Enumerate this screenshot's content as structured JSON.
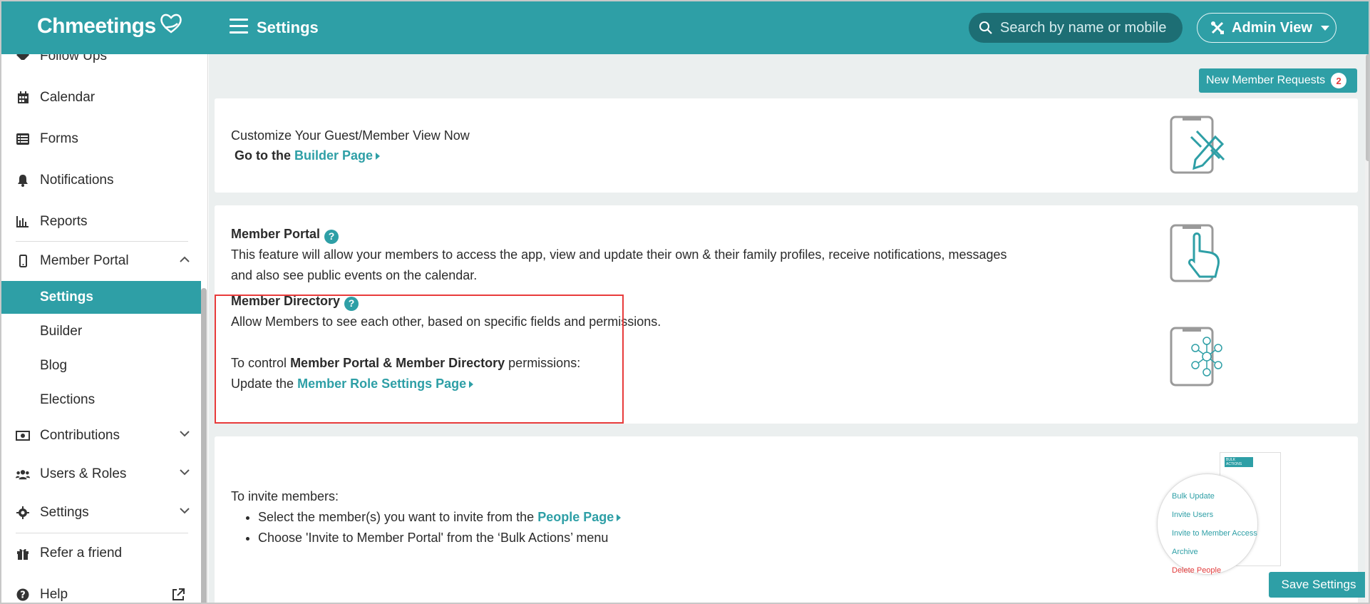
{
  "app": {
    "logo_text": "Chmeetings",
    "page_title": "Settings",
    "brand_color": "#2e9fa6"
  },
  "header": {
    "search_placeholder": "Search by name or mobile",
    "admin_view_label": "Admin View"
  },
  "sidebar": {
    "items": [
      {
        "label": "Follow Ups",
        "icon": "handshake-icon"
      },
      {
        "label": "Calendar",
        "icon": "calendar-icon"
      },
      {
        "label": "Forms",
        "icon": "list-icon"
      },
      {
        "label": "Notifications",
        "icon": "bell-icon"
      },
      {
        "label": "Reports",
        "icon": "bar-chart-icon"
      },
      {
        "label": "Member Portal",
        "icon": "mobile-icon"
      },
      {
        "label": "Contributions",
        "icon": "money-icon"
      },
      {
        "label": "Users & Roles",
        "icon": "users-icon"
      },
      {
        "label": "Settings",
        "icon": "gear-icon"
      },
      {
        "label": "Refer a friend",
        "icon": "gift-icon"
      },
      {
        "label": "Help",
        "icon": "question-icon"
      }
    ],
    "member_portal_sub": [
      "Settings",
      "Builder",
      "Blog",
      "Elections"
    ]
  },
  "main": {
    "new_member_requests_label": "New Member Requests",
    "new_member_requests_count": "2",
    "customize": {
      "line1": "Customize Your Guest/Member View Now",
      "go_to": "Go to the",
      "builder_link": "Builder Page"
    },
    "member_portal": {
      "title": "Member Portal",
      "description_line1": "This feature will allow your members to access the app, view and update their own & their family profiles, receive notifications, messages",
      "description_line2": "and also see public events on the calendar."
    },
    "member_directory": {
      "title": "Member Directory",
      "description": "Allow Members to see each other, based on specific fields and permissions.",
      "control_prefix": "To control",
      "control_bold": "Member Portal & Member Directory",
      "control_suffix": "permissions:",
      "update_prefix": "Update the",
      "role_link": "Member Role Settings Page"
    },
    "invite": {
      "heading": "To invite members:",
      "step1_prefix": "Select the member(s) you want to invite from the",
      "step1_link": "People Page",
      "step2": "Choose 'Invite to Member Portal' from the ‘Bulk Actions’ menu",
      "illustration_menu": [
        "Bulk Update",
        "Invite Users",
        "Invite to Member Access",
        "Archive",
        "Delete People"
      ],
      "illustration_header": "BULK ACTIONS"
    },
    "save_label": "Save Settings"
  }
}
